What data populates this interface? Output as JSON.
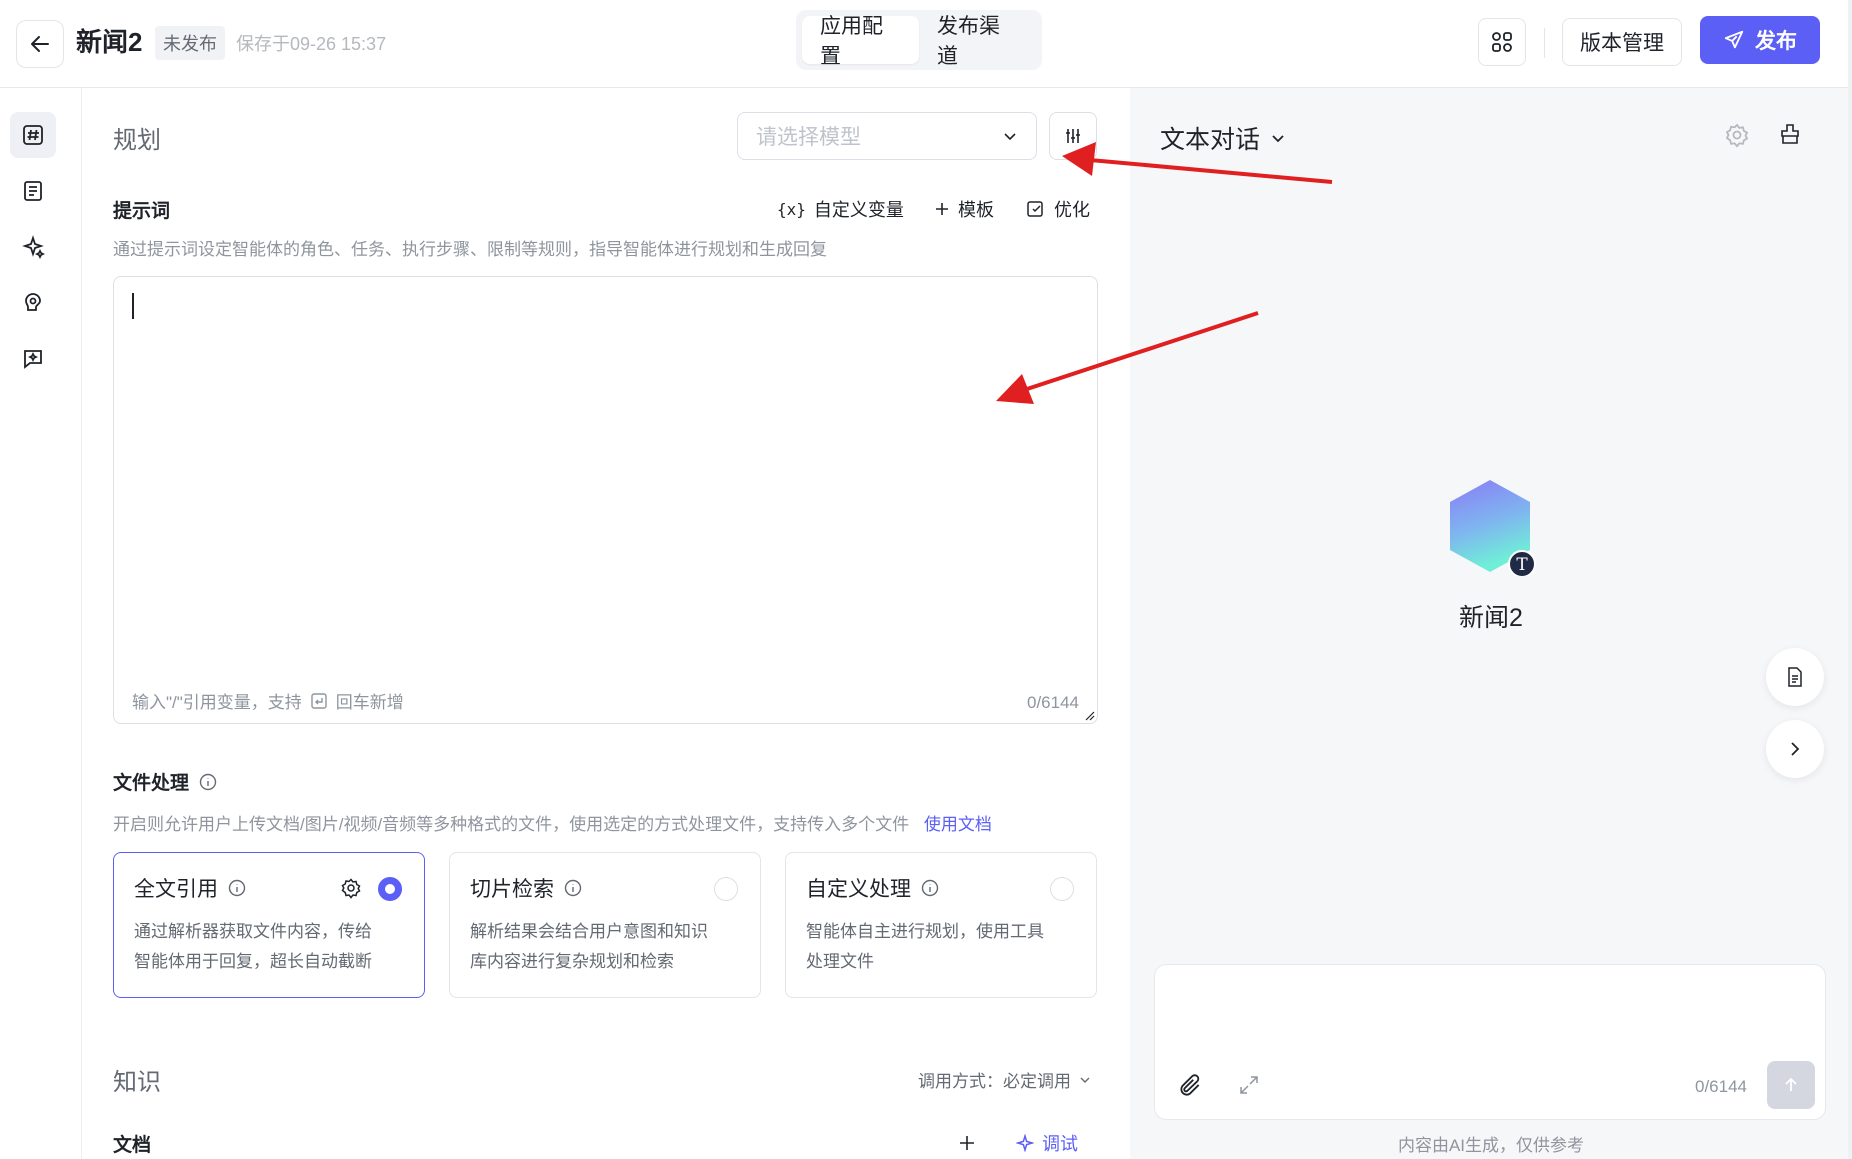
{
  "header": {
    "title": "新闻2",
    "status": "未发布",
    "saved": "保存于09-26 15:37",
    "tabs": [
      {
        "label": "应用配置",
        "active": true
      },
      {
        "label": "发布渠道",
        "active": false
      }
    ],
    "version_label": "版本管理",
    "publish_label": "发布",
    "icons": [
      "back-arrow-icon",
      "app-grid-icon",
      "send-icon"
    ]
  },
  "rail": {
    "items": [
      {
        "name": "prompt",
        "icon": "hash-icon",
        "active": true
      },
      {
        "name": "variables",
        "icon": "list-icon",
        "active": false
      },
      {
        "name": "skills",
        "icon": "sparkle-icon",
        "active": false
      },
      {
        "name": "memory",
        "icon": "brain-icon",
        "active": false
      },
      {
        "name": "dialog",
        "icon": "chat-ai-icon",
        "active": false
      }
    ]
  },
  "center": {
    "planning_title": "规划",
    "model_placeholder": "请选择模型",
    "prompt": {
      "label": "提示词",
      "custom_var": "自定义变量",
      "template": "模板",
      "optimize": "优化",
      "hint": "通过提示词设定智能体的角色、任务、执行步骤、限制等规则，指导智能体进行规划和生成回复",
      "foot": "输入\"/\"引用变量，支持",
      "foot_tail": "回车新增",
      "count": "0/6144"
    },
    "file": {
      "label": "文件处理",
      "hint": "开启则允许用户上传文档/图片/视频/音频等多种格式的文件，使用选定的方式处理文件，支持传入多个文件",
      "doc_link": "使用文档",
      "cards": [
        {
          "title": "全文引用",
          "desc1": "通过解析器获取文件内容，传给",
          "desc2": "智能体用于回复，超长自动截断",
          "selected": true
        },
        {
          "title": "切片检索",
          "desc1": "解析结果会结合用户意图和知识",
          "desc2": "库内容进行复杂规划和检索",
          "selected": false
        },
        {
          "title": "自定义处理",
          "desc1": "智能体自主进行规划，使用工具",
          "desc2": "处理文件",
          "selected": false
        }
      ]
    },
    "knowledge": {
      "title": "知识",
      "call_mode": "调用方式：必定调用",
      "doc_label": "文档",
      "debug": "调试"
    }
  },
  "right": {
    "mode": "文本对话",
    "agent_name": "新闻2",
    "avatar_badge": "T",
    "count": "0/6144",
    "disclaimer": "内容由AI生成，仅供参考"
  },
  "colors": {
    "accent": "#5b5ff5",
    "annotation": "#e02020"
  }
}
